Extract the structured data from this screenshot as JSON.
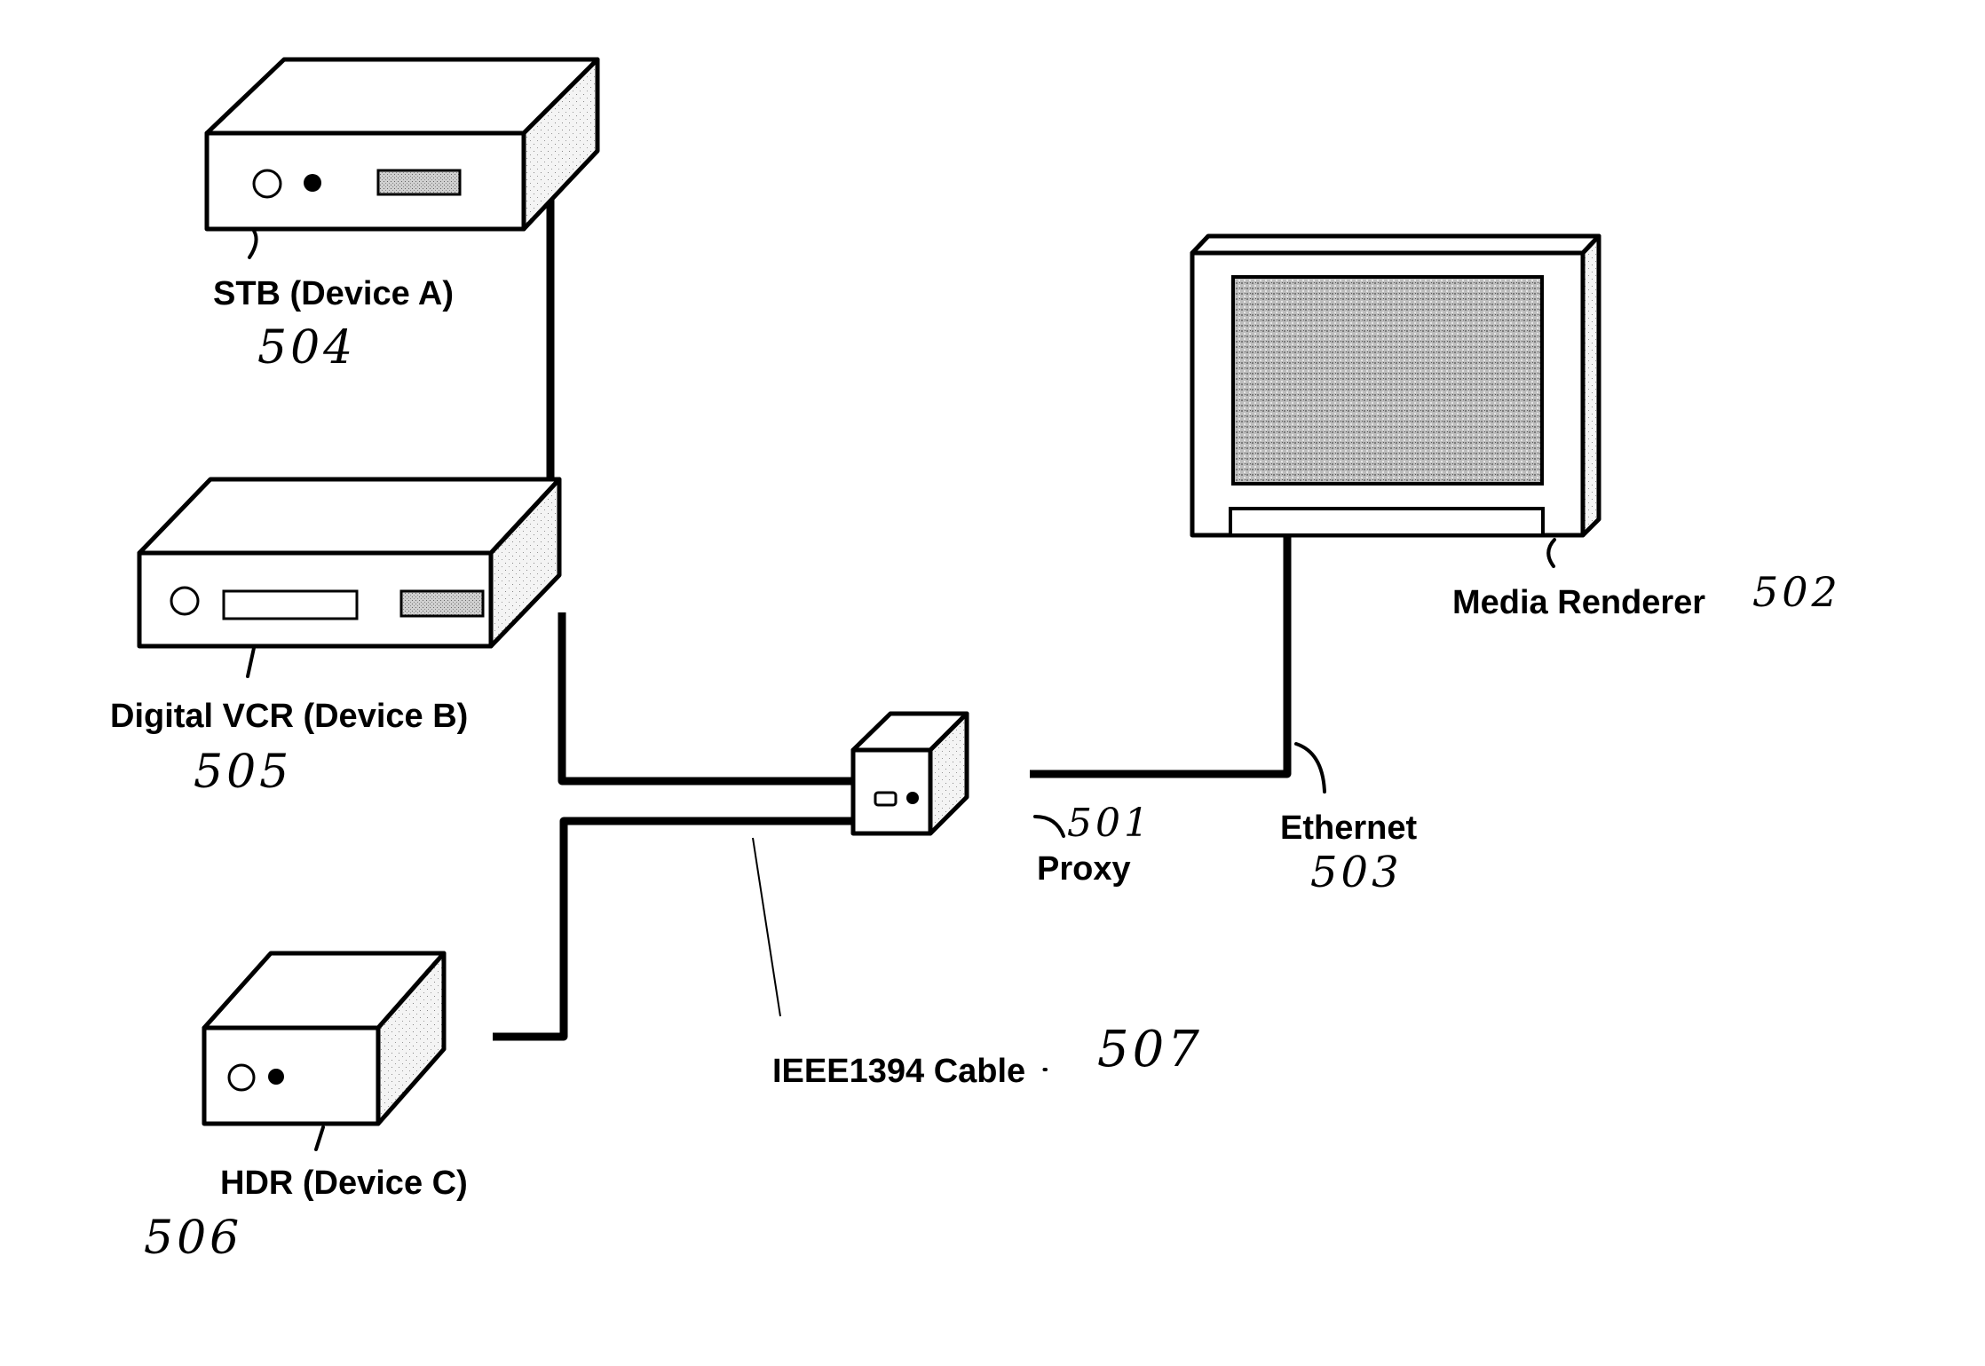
{
  "figure": {
    "devices": [
      {
        "id": "stb",
        "label": "STB (Device A)",
        "ref": "504"
      },
      {
        "id": "vcr",
        "label": "Digital VCR (Device B)",
        "ref": "505"
      },
      {
        "id": "hdr",
        "label": "HDR (Device C)",
        "ref": "506"
      },
      {
        "id": "proxy",
        "label": "Proxy",
        "ref": "501"
      },
      {
        "id": "renderer",
        "label": "Media Renderer",
        "ref": "502"
      }
    ],
    "links": [
      {
        "id": "ethernet",
        "label": "Ethernet",
        "ref": "503"
      },
      {
        "id": "ieee1394",
        "label": "IEEE1394 Cable",
        "ref": "507"
      }
    ]
  }
}
